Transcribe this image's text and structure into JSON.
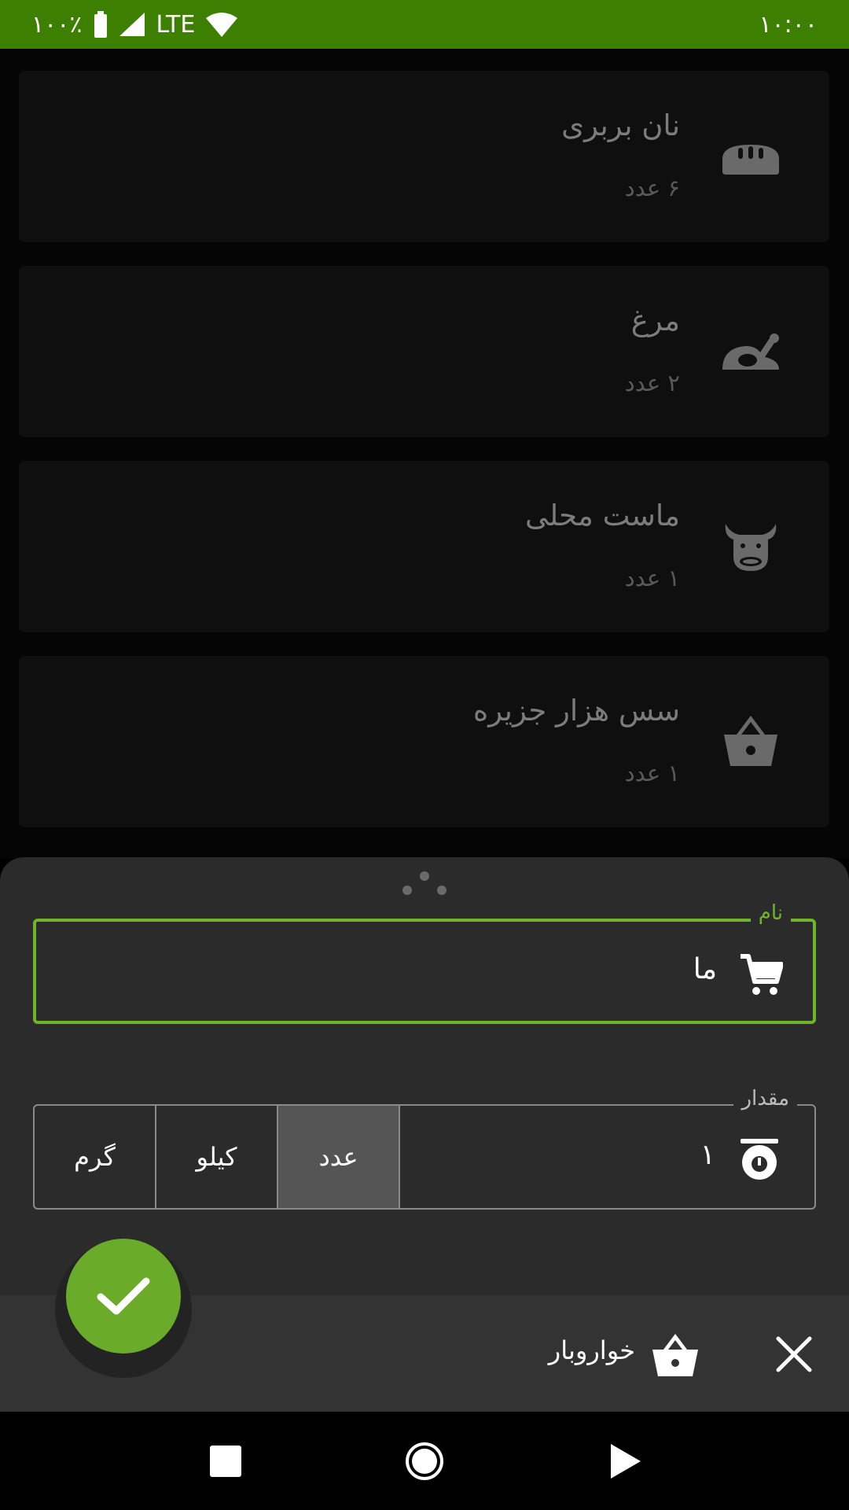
{
  "status_bar": {
    "battery": "۱۰۰٪",
    "network": "LTE",
    "time": "۱۰:۰۰"
  },
  "items": [
    {
      "name": "نان بربری",
      "qty": "۶ عدد",
      "icon": "bread-icon"
    },
    {
      "name": "مرغ",
      "qty": "۲ عدد",
      "icon": "chicken-icon"
    },
    {
      "name": "ماست محلی",
      "qty": "۱ عدد",
      "icon": "cow-icon"
    },
    {
      "name": "سس هزار جزیره",
      "qty": "۱ عدد",
      "icon": "basket-icon"
    }
  ],
  "sheet": {
    "name_label": "نام",
    "name_value": "ما",
    "amount_label": "مقدار",
    "amount_value": "۱",
    "units": [
      "گرم",
      "کیلو",
      "عدد"
    ],
    "selected_unit": "عدد"
  },
  "appbar": {
    "category": "خواروبار"
  },
  "colors": {
    "status_bar": "#3d7f00",
    "accent": "#6fb52c",
    "fab": "#6aab2a"
  }
}
